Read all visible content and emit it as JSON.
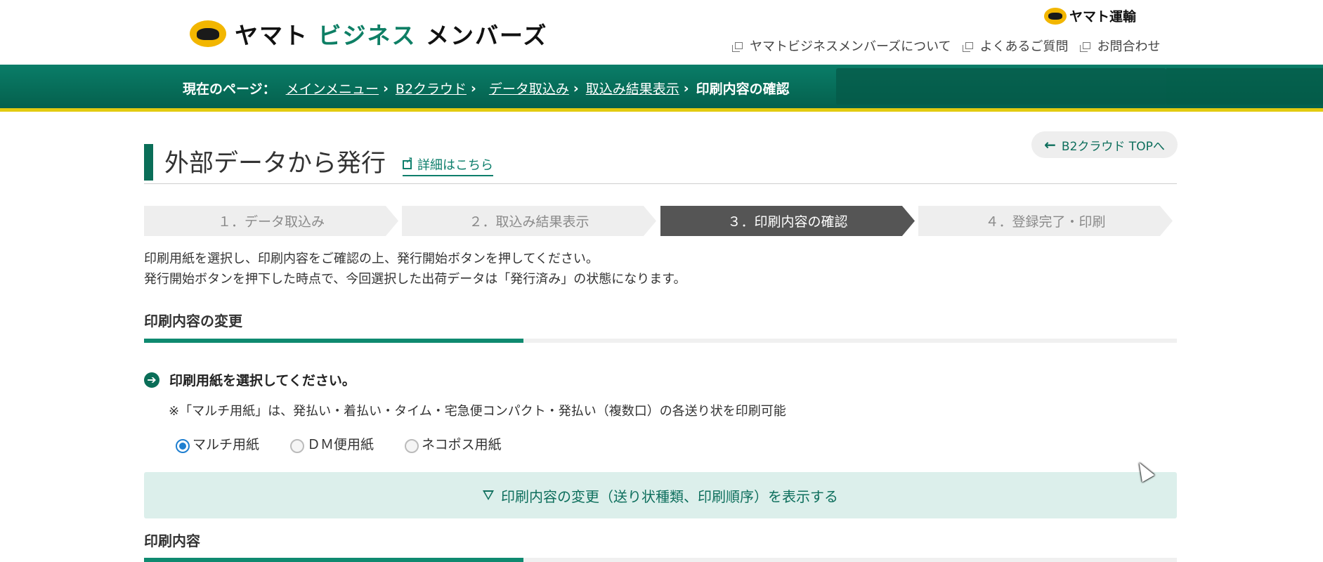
{
  "header": {
    "logo_text": "ヤマト ビジネス メンバーズ",
    "logo_text_part1": "ヤマト",
    "logo_text_part2": "ビジネス",
    "logo_text_part3": "メンバーズ",
    "corp_logo": "ヤマト運輸",
    "links": [
      {
        "label": "ヤマトビジネスメンバーズについて",
        "icon": "window-icon"
      },
      {
        "label": "よくあるご質問",
        "icon": "window-icon"
      },
      {
        "label": "お問合わせ",
        "icon": "window-icon"
      }
    ]
  },
  "breadcrumb": {
    "label": "現在のページ：",
    "items": [
      "メインメニュー",
      "B2クラウド",
      "データ取込み",
      "取込み結果表示"
    ],
    "current": "印刷内容の確認"
  },
  "title": {
    "text": "外部データから発行",
    "detail_link": "詳細はこちら",
    "top_button": "B2クラウド TOPへ"
  },
  "steps": [
    {
      "label": "１．データ取込み",
      "active": false
    },
    {
      "label": "２．取込み結果表示",
      "active": false
    },
    {
      "label": "３．印刷内容の確認",
      "active": true
    },
    {
      "label": "４．登録完了・印刷",
      "active": false
    }
  ],
  "intro": {
    "line1": "印刷用紙を選択し、印刷内容をご確認の上、発行開始ボタンを押してください。",
    "line2": "発行開始ボタンを押下した時点で、今回選択した出荷データは「発行済み」の状態になります。"
  },
  "section_change": {
    "heading": "印刷内容の変更",
    "question": "印刷用紙を選択してください。",
    "note": "※「マルチ用紙」は、発払い・着払い・タイム・宅急便コンパクト・発払い（複数口）の各送り状を印刷可能",
    "options": [
      {
        "label": "マルチ用紙",
        "selected": true
      },
      {
        "label": "ＤＭ便用紙",
        "selected": false
      },
      {
        "label": "ネコポス用紙",
        "selected": false
      }
    ],
    "toggle_label": "印刷内容の変更（送り状種類、印刷順序）を表示する"
  },
  "section_content": {
    "heading": "印刷内容"
  },
  "colors": {
    "brand_green": "#0a7d68",
    "accent_yellow": "#e2cb10",
    "active_step": "#555555"
  }
}
